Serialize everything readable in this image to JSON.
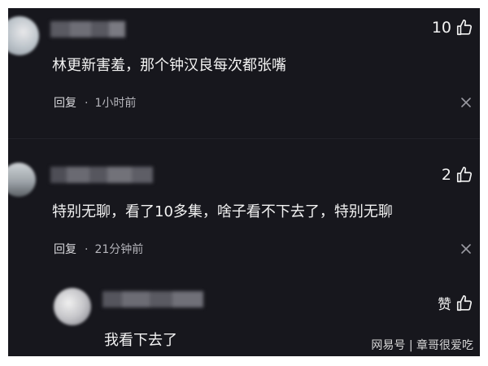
{
  "comments": [
    {
      "text": "林更新害羞，那个钟汉良每次都张嘴",
      "reply_label": "回复",
      "separator": "·",
      "time": "1小时前",
      "likes": "10",
      "close_icon": "close-icon"
    },
    {
      "text": "特别无聊，看了10多集，啥子看不下去了，特别无聊",
      "reply_label": "回复",
      "separator": "·",
      "time": "21分钟前",
      "likes": "2",
      "close_icon": "close-icon"
    }
  ],
  "reply": {
    "text": "我看下去了",
    "like_label": "赞"
  },
  "watermark": "网易号 | 章哥很爱吃",
  "colors": {
    "background": "#17171d",
    "text": "#f2f2f2",
    "meta": "#b5b5bb",
    "icon": "#9a9aa2"
  },
  "icons": [
    "thumbs-up-icon",
    "close-icon"
  ]
}
